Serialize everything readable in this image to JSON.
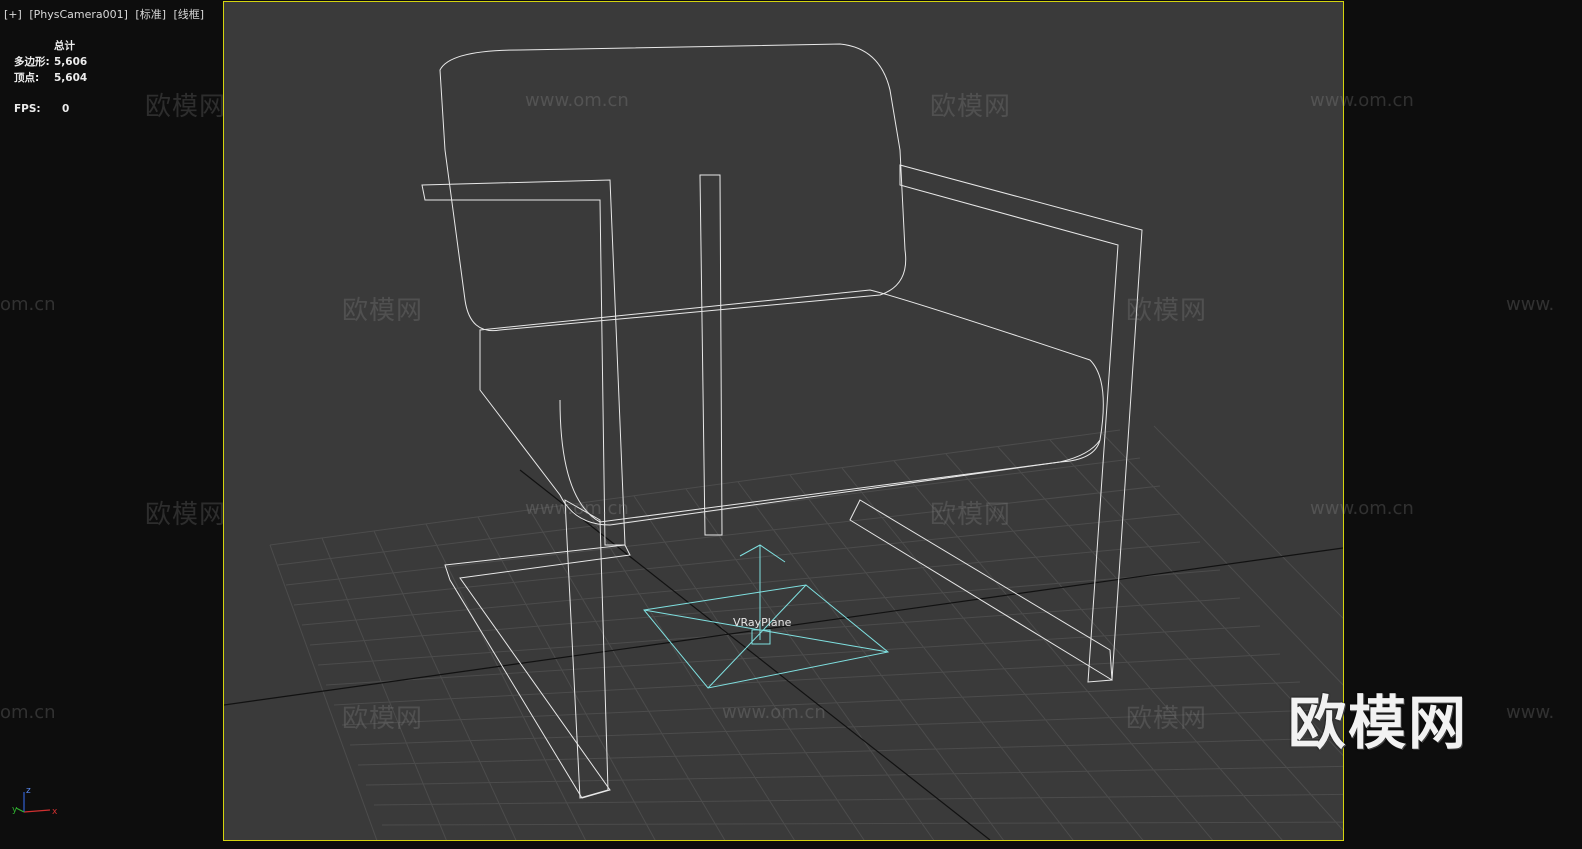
{
  "viewport": {
    "label_parts": [
      "[+]",
      "[PhysCamera001]",
      "[标准]",
      "[线框]"
    ],
    "frame_color": "#d4d40e",
    "background": "#3a3a3a"
  },
  "stats": {
    "header": "总计",
    "polygons_label": "多边形:",
    "polygons_value": "5,606",
    "vertices_label": "顶点:",
    "vertices_value": "5,604",
    "fps_label": "FPS:",
    "fps_value": "0"
  },
  "scene": {
    "object_label": "VRayPlane",
    "wire_color": "#e8e8e8",
    "helper_color": "#7fe0e0"
  },
  "watermark": {
    "text": "欧模网",
    "url": "www.om.cn",
    "url_fragment": "om.cn",
    "url_prefix": "www.",
    "logo_text": "欧模网"
  },
  "axis": {
    "x": "x",
    "y": "y",
    "z": "z"
  }
}
